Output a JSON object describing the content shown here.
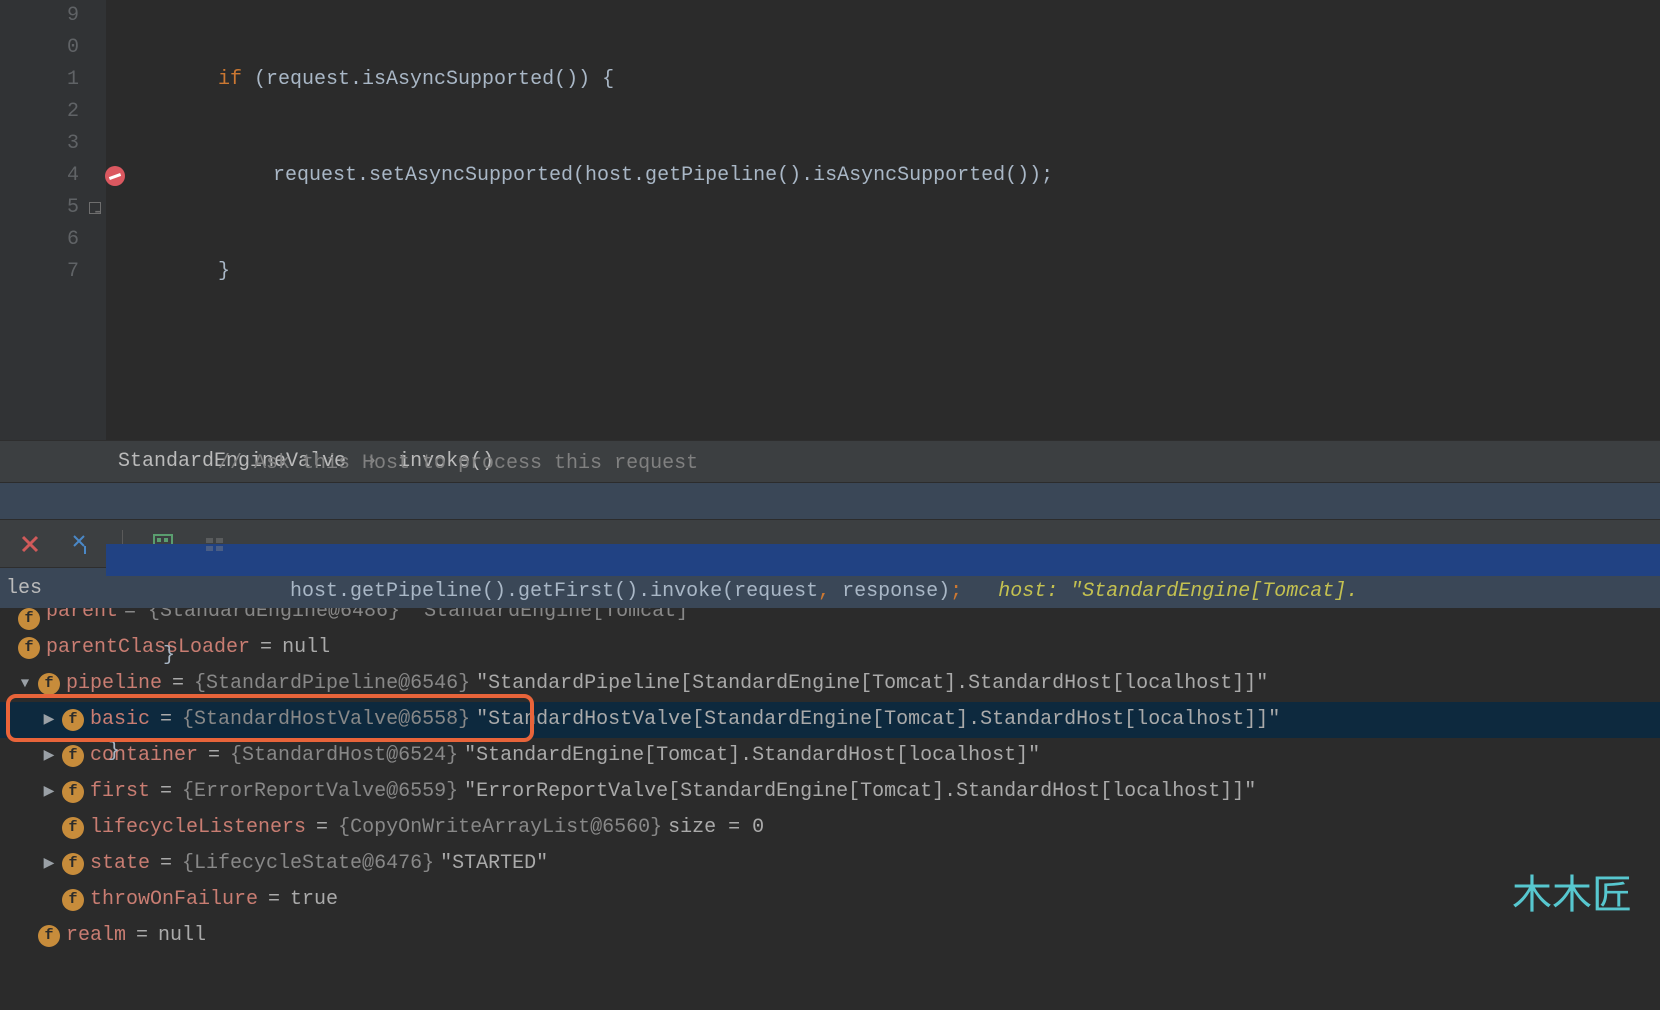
{
  "editor": {
    "lines": [
      {
        "num": "9"
      },
      {
        "num": "0"
      },
      {
        "num": "1"
      },
      {
        "num": "2"
      },
      {
        "num": "3"
      },
      {
        "num": "4"
      },
      {
        "num": "5"
      },
      {
        "num": "6"
      },
      {
        "num": "7"
      }
    ],
    "code": {
      "l1_kw": "if",
      "l1_rest": " (request.isAsyncSupported()) {",
      "l2": "request.setAsyncSupported(host.getPipeline().isAsyncSupported());",
      "l3": "}",
      "l4": "// Ask this Host to process this request",
      "l5_a": "host.getPipeline().getFirst().invoke(request",
      "l5_comma": ",",
      "l5_b": " response)",
      "l5_semi": ";",
      "l5_hint_label": "host:",
      "l5_hint_val": "\"StandardEngine[Tomcat].",
      "l6": "}",
      "l7": "}"
    }
  },
  "breadcrumb": {
    "a": "StandardEngineValve",
    "b": "invoke()"
  },
  "panel_header": "les",
  "vars": {
    "r0_name": "parent",
    "r0_rest": " = {StandardEngine@6486} \"StandardEngine[Tomcat]\"",
    "r1_name": "parentClassLoader",
    "r1_val": "null",
    "r2_name": "pipeline",
    "r2_type": "{StandardPipeline@6546}",
    "r2_val": "\"StandardPipeline[StandardEngine[Tomcat].StandardHost[localhost]]\"",
    "r3_name": "basic",
    "r3_type": "{StandardHostValve@6558}",
    "r3_val": "\"StandardHostValve[StandardEngine[Tomcat].StandardHost[localhost]]\"",
    "r4_name": "container",
    "r4_type": "{StandardHost@6524}",
    "r4_val": "\"StandardEngine[Tomcat].StandardHost[localhost]\"",
    "r5_name": "first",
    "r5_type": "{ErrorReportValve@6559}",
    "r5_val": "\"ErrorReportValve[StandardEngine[Tomcat].StandardHost[localhost]]\"",
    "r6_name": "lifecycleListeners",
    "r6_type": "{CopyOnWriteArrayList@6560}",
    "r6_val": " size = 0",
    "r7_name": "state",
    "r7_type": "{LifecycleState@6476}",
    "r7_val": "\"STARTED\"",
    "r8_name": "throwOnFailure",
    "r8_val": "true",
    "r9_name": "realm",
    "r9_val": "null"
  },
  "watermark": "木木匠"
}
